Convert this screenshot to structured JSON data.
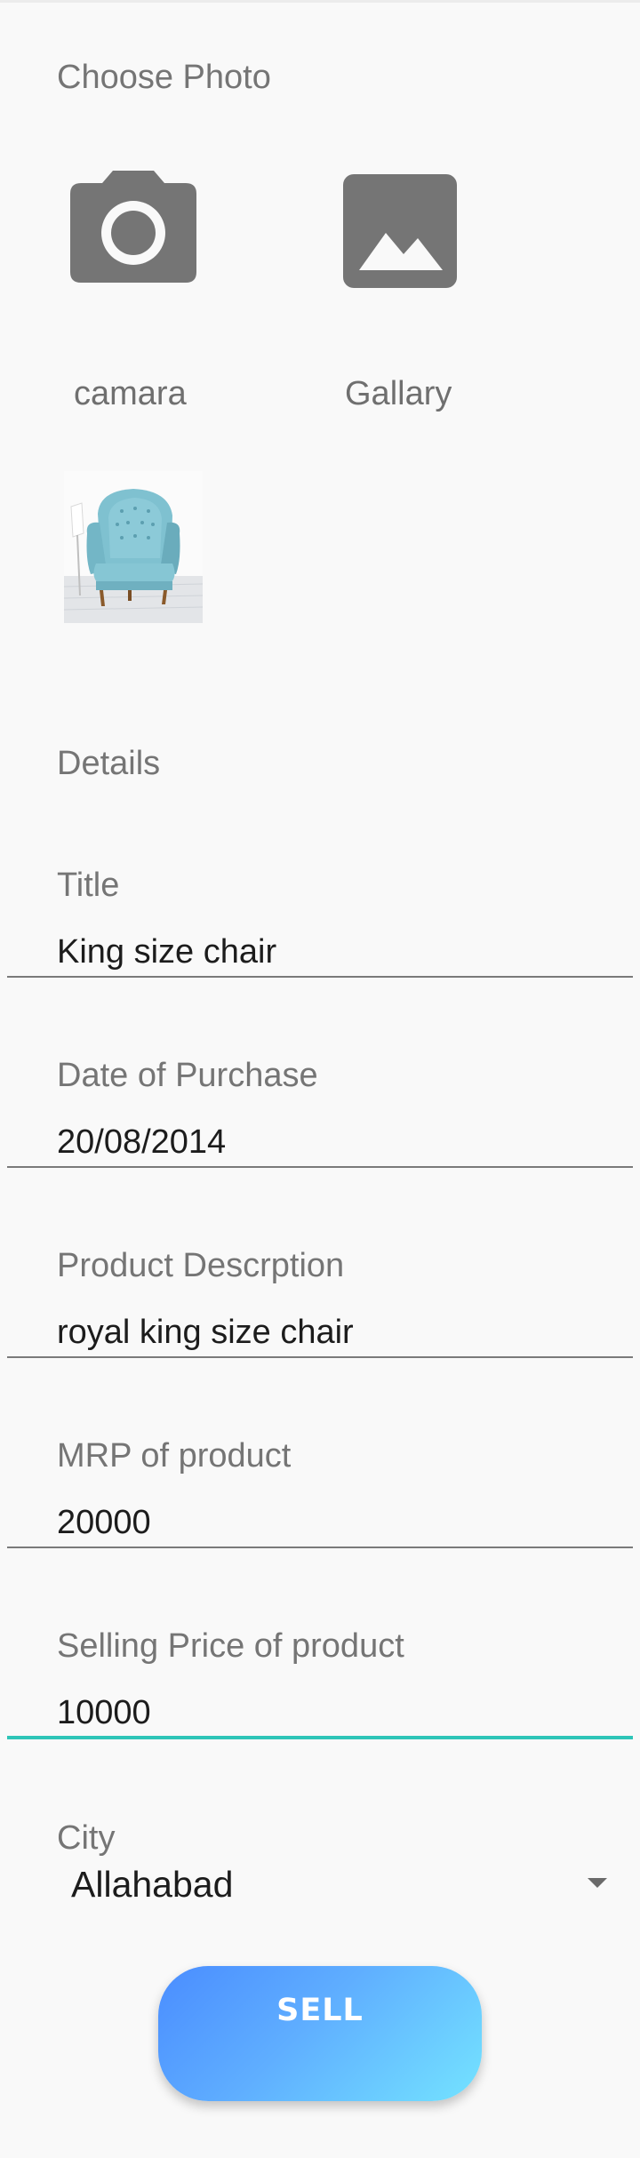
{
  "photo_section": {
    "title": "Choose Photo",
    "camera_label": "camara",
    "gallery_label": "Gallary",
    "camera_icon": "camera-icon",
    "gallery_icon": "image-icon"
  },
  "details_section": {
    "title": "Details"
  },
  "fields": {
    "title": {
      "label": "Title",
      "value": "King size chair"
    },
    "date": {
      "label": "Date of Purchase",
      "value": "20/08/2014"
    },
    "description": {
      "label": "Product Descrption",
      "value": "royal king size chair"
    },
    "mrp": {
      "label": "MRP of product",
      "value": "20000"
    },
    "selling_price": {
      "label": "Selling Price of product",
      "value": "10000"
    }
  },
  "city": {
    "label": "City",
    "selected": "Allahabad",
    "dropdown_icon": "dropdown-arrow-icon"
  },
  "sell_button": {
    "label": "SELL"
  },
  "colors": {
    "accent": "#2ec5b8",
    "button_gradient_start": "#4a8dff",
    "button_gradient_end": "#74e3ff",
    "icon_gray": "#757575"
  }
}
